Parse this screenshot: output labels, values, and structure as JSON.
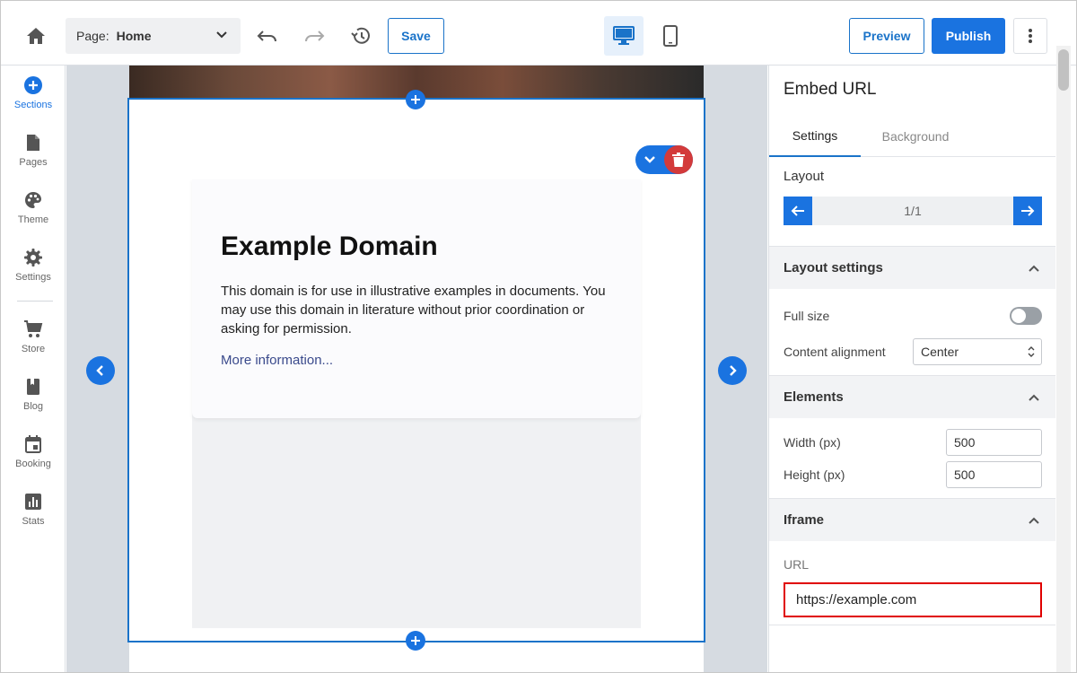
{
  "topbar": {
    "page_label": "Page:",
    "page_value": "Home",
    "save_label": "Save",
    "preview_label": "Preview",
    "publish_label": "Publish"
  },
  "sidebar": {
    "items": [
      {
        "label": "Sections",
        "icon": "plus-circle-icon",
        "active": true
      },
      {
        "label": "Pages",
        "icon": "file-icon"
      },
      {
        "label": "Theme",
        "icon": "palette-icon"
      },
      {
        "label": "Settings",
        "icon": "gear-icon"
      },
      {
        "label": "Store",
        "icon": "cart-icon"
      },
      {
        "label": "Blog",
        "icon": "book-icon"
      },
      {
        "label": "Booking",
        "icon": "calendar-icon"
      },
      {
        "label": "Stats",
        "icon": "bar-chart-icon"
      }
    ]
  },
  "canvas": {
    "embed": {
      "heading": "Example Domain",
      "paragraph": "This domain is for use in illustrative examples in documents. You may use this domain in literature without prior coordination or asking for permission.",
      "link": "More information..."
    }
  },
  "panel": {
    "title": "Embed URL",
    "tabs": [
      "Settings",
      "Background"
    ],
    "layout_label": "Layout",
    "layout_value": "1/1",
    "layout_settings": {
      "heading": "Layout settings",
      "full_size_label": "Full size",
      "full_size_on": false,
      "alignment_label": "Content alignment",
      "alignment_value": "Center"
    },
    "elements": {
      "heading": "Elements",
      "width_label": "Width (px)",
      "width_value": "500",
      "height_label": "Height (px)",
      "height_value": "500"
    },
    "iframe": {
      "heading": "Iframe",
      "url_label": "URL",
      "url_value": "https://example.com"
    }
  },
  "colors": {
    "accent": "#1a73e0",
    "delete": "#d33a3a",
    "highlight_border": "#e00000"
  }
}
